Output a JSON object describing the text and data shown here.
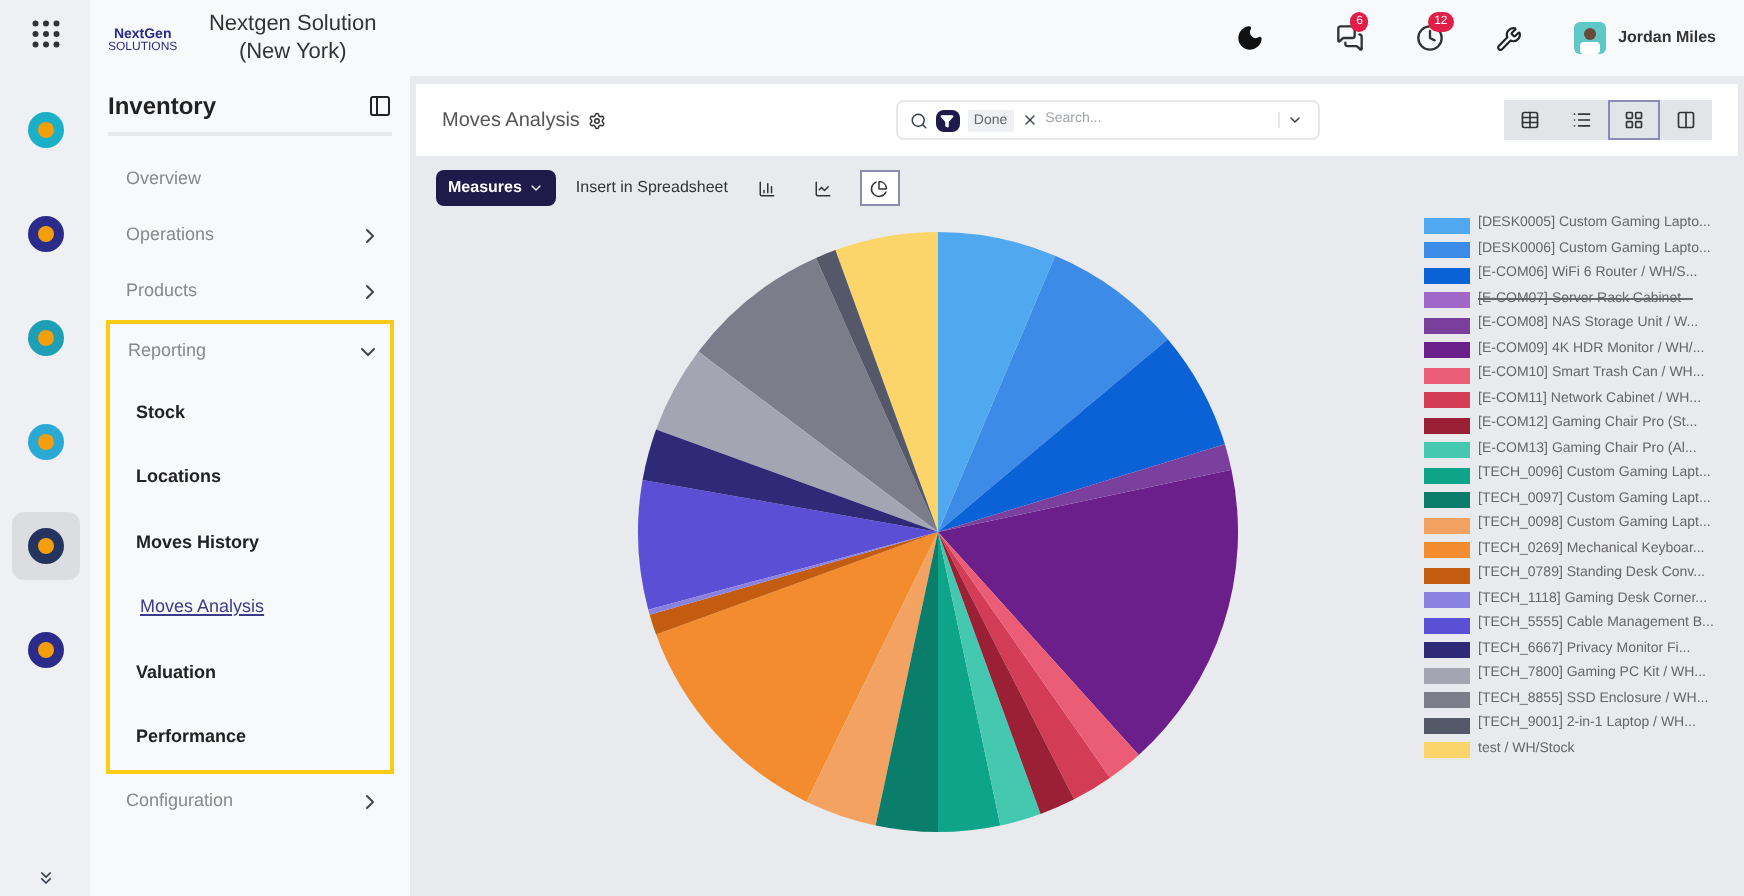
{
  "company": {
    "name": "Nextgen Solution (New York)",
    "logo_text": "NextGen",
    "logo_sub": "SOLUTIONS"
  },
  "header": {
    "messages_badge": "6",
    "activity_badge": "12",
    "user": "Jordan Miles"
  },
  "sidebar": {
    "title": "Inventory",
    "items": [
      {
        "label": "Overview",
        "kind": "link",
        "expanded": false
      },
      {
        "label": "Operations",
        "kind": "group",
        "expanded": false
      },
      {
        "label": "Products",
        "kind": "group",
        "expanded": false
      },
      {
        "label": "Reporting",
        "kind": "group",
        "expanded": true,
        "children": [
          {
            "label": "Stock",
            "selected": false
          },
          {
            "label": "Locations",
            "selected": false
          },
          {
            "label": "Moves History",
            "selected": false
          },
          {
            "label": "Moves Analysis",
            "selected": true
          },
          {
            "label": "Valuation",
            "selected": false
          },
          {
            "label": "Performance",
            "selected": false
          }
        ]
      },
      {
        "label": "Configuration",
        "kind": "group",
        "expanded": false
      }
    ]
  },
  "view": {
    "title": "Moves Analysis",
    "filter": "Done",
    "search_placeholder": "Search...",
    "measures": "Measures",
    "insert": "Insert in Spreadsheet",
    "chart_types": [
      {
        "kind": "bar",
        "selected": false
      },
      {
        "kind": "line",
        "selected": false
      },
      {
        "kind": "pie",
        "selected": true
      }
    ],
    "view_switch": [
      {
        "kind": "pivot",
        "selected": false
      },
      {
        "kind": "list",
        "selected": false
      },
      {
        "kind": "graph",
        "selected": true
      },
      {
        "kind": "cohort",
        "selected": false
      }
    ]
  },
  "legend": [
    {
      "label": "[DESK0005] Custom Gaming Lapto...",
      "color": "#4fa8f0",
      "hidden": false
    },
    {
      "label": "[DESK0006] Custom Gaming Lapto...",
      "color": "#3c8be6",
      "hidden": false
    },
    {
      "label": "[E-COM06] WiFi 6 Router / WH/S...",
      "color": "#0b62d6",
      "hidden": false
    },
    {
      "label": "[E-COM07] Server Rack Cabinet –",
      "color": "#a066c8",
      "hidden": true
    },
    {
      "label": "[E-COM08] NAS Storage Unit / W...",
      "color": "#7b3f9e",
      "hidden": false
    },
    {
      "label": "[E-COM09] 4K HDR Monitor / WH/...",
      "color": "#6a1f8a",
      "hidden": false
    },
    {
      "label": "[E-COM10] Smart Trash Can / WH...",
      "color": "#ea5d75",
      "hidden": false
    },
    {
      "label": "[E-COM11] Network Cabinet / WH...",
      "color": "#d23d55",
      "hidden": false
    },
    {
      "label": "[E-COM12] Gaming Chair Pro (St...",
      "color": "#9b1f35",
      "hidden": false
    },
    {
      "label": "[E-COM13] Gaming Chair Pro (Al...",
      "color": "#45c8b0",
      "hidden": false
    },
    {
      "label": "[TECH_0096] Custom Gaming Lapt...",
      "color": "#0ea48a",
      "hidden": false
    },
    {
      "label": "[TECH_0097] Custom Gaming Lapt...",
      "color": "#0b7d6b",
      "hidden": false
    },
    {
      "label": "[TECH_0098] Custom Gaming Lapt...",
      "color": "#f4a261",
      "hidden": false
    },
    {
      "label": "[TECH_0269] Mechanical Keyboar...",
      "color": "#f28c2e",
      "hidden": false
    },
    {
      "label": "[TECH_0789] Standing Desk Conv...",
      "color": "#c45c10",
      "hidden": false
    },
    {
      "label": "[TECH_1118] Gaming Desk Corner...",
      "color": "#8a82e0",
      "hidden": false
    },
    {
      "label": "[TECH_5555] Cable Management B...",
      "color": "#5b4fd6",
      "hidden": false
    },
    {
      "label": "[TECH_6667] Privacy Monitor Fi...",
      "color": "#2f2a78",
      "hidden": false
    },
    {
      "label": "[TECH_7800] Gaming PC Kit / WH...",
      "color": "#a3a6b2",
      "hidden": false
    },
    {
      "label": "[TECH_8855] SSD Enclosure / WH...",
      "color": "#7b7e8a",
      "hidden": false
    },
    {
      "label": "[TECH_9001] 2-in-1 Laptop / WH...",
      "color": "#545868",
      "hidden": false
    },
    {
      "label": "test / WH/Stock",
      "color": "#fbd56a",
      "hidden": false
    }
  ]
}
